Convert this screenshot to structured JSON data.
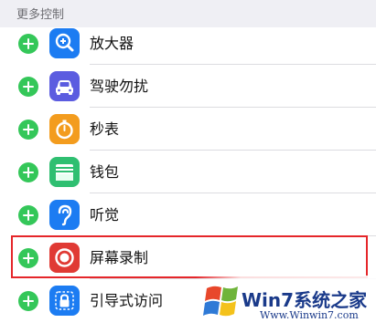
{
  "section": {
    "title": "更多控制"
  },
  "controls": [
    {
      "label": "放大器",
      "icon": "magnifier-icon",
      "color": "#1c7cf2"
    },
    {
      "label": "驾驶勿扰",
      "icon": "car-icon",
      "color": "#5b5ce0"
    },
    {
      "label": "秒表",
      "icon": "stopwatch-icon",
      "color": "#f39c1e"
    },
    {
      "label": "钱包",
      "icon": "wallet-icon",
      "color": "#2fbf71"
    },
    {
      "label": "听觉",
      "icon": "ear-icon",
      "color": "#1c7cf2"
    },
    {
      "label": "屏幕录制",
      "icon": "screen-record-icon",
      "color": "#e03a34"
    },
    {
      "label": "引导式访问",
      "icon": "lock-icon",
      "color": "#1c7cf2"
    }
  ],
  "add_color": "#34c759",
  "highlight_color": "#e5262a",
  "watermark": {
    "brand": "Win7系统之家",
    "url": "Www.Winwin7.com"
  }
}
